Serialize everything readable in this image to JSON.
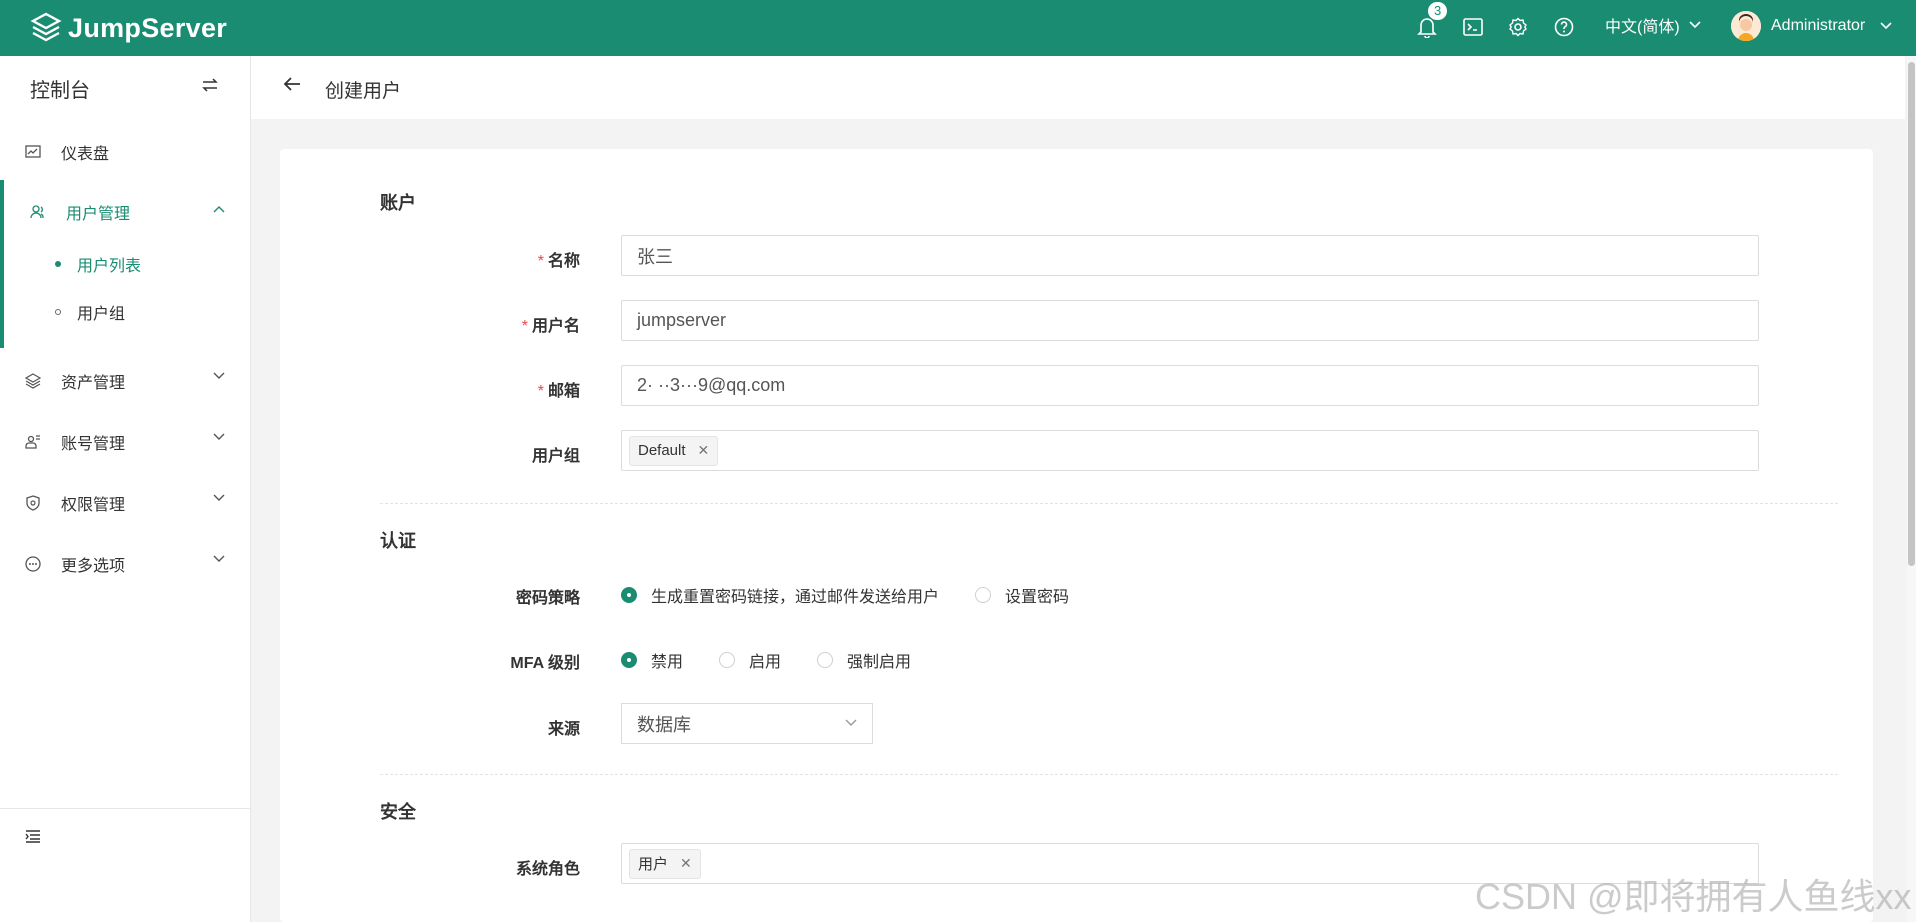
{
  "app": {
    "name": "JumpServer"
  },
  "topbar": {
    "notification_count": "3",
    "language": "中文(简体)",
    "username": "Administrator"
  },
  "sidebar": {
    "title": "控制台",
    "items": [
      {
        "label": "仪表盘",
        "icon": "dashboard-icon"
      },
      {
        "label": "用户管理",
        "icon": "users-icon",
        "expanded": true,
        "children": [
          {
            "label": "用户列表",
            "active": true
          },
          {
            "label": "用户组"
          }
        ]
      },
      {
        "label": "资产管理",
        "icon": "layers-icon"
      },
      {
        "label": "账号管理",
        "icon": "account-icon"
      },
      {
        "label": "权限管理",
        "icon": "shield-icon"
      },
      {
        "label": "更多选项",
        "icon": "more-icon"
      }
    ]
  },
  "page": {
    "title": "创建用户"
  },
  "form": {
    "account": {
      "section_title": "账户",
      "name_label": "名称",
      "name_value": "张三",
      "username_label": "用户名",
      "username_value": "jumpserver",
      "email_label": "邮箱",
      "email_value": "2·  ··3···9@qq.com",
      "groups_label": "用户组",
      "groups": [
        "Default"
      ]
    },
    "auth": {
      "section_title": "认证",
      "password_strategy_label": "密码策略",
      "password_options": [
        "生成重置密码链接，通过邮件发送给用户",
        "设置密码"
      ],
      "password_selected": 0,
      "mfa_label": "MFA 级别",
      "mfa_options": [
        "禁用",
        "启用",
        "强制启用"
      ],
      "mfa_selected": 0,
      "source_label": "来源",
      "source_value": "数据库"
    },
    "security": {
      "section_title": "安全",
      "system_roles_label": "系统角色",
      "system_roles": [
        "用户"
      ]
    }
  },
  "watermark": "CSDN @即将拥有人鱼线xx",
  "colors": {
    "brand": "#1a8c72",
    "required": "#e84a4a"
  }
}
